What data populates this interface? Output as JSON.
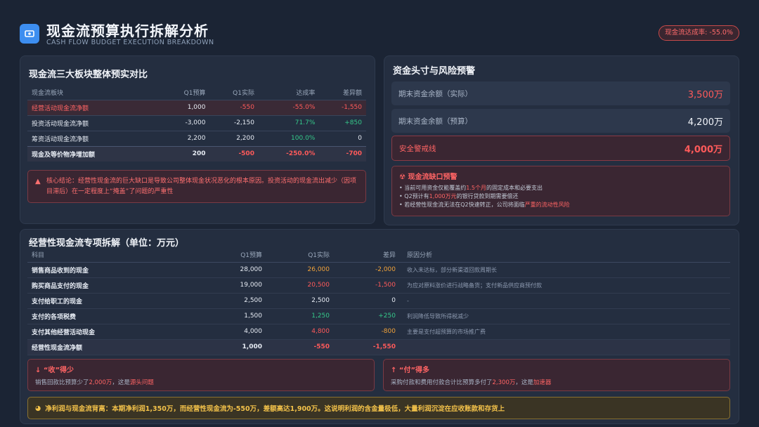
{
  "header": {
    "title": "现金流预算执行拆解分析",
    "subtitle": "CASH FLOW BUDGET EXECUTION BREAKDOWN",
    "rate_badge": "现金流达成率: -55.0%"
  },
  "panel_overview": {
    "title": "现金流三大板块整体预实对比",
    "columns": [
      "现金流板块",
      "Q1预算",
      "Q1实际",
      "达成率",
      "差异额"
    ],
    "rows": [
      {
        "name": "经营活动现金流净额",
        "budget": "1,000",
        "actual": "-550",
        "rate": "-55.0%",
        "diff": "-1,550"
      },
      {
        "name": "投资活动现金流净额",
        "budget": "-3,000",
        "actual": "-2,150",
        "rate": "71.7%",
        "diff": "+850"
      },
      {
        "name": "筹资活动现金流净额",
        "budget": "2,200",
        "actual": "2,200",
        "rate": "100.0%",
        "diff": "0"
      },
      {
        "name": "现金及等价物净增加额",
        "budget": "200",
        "actual": "-500",
        "rate": "-250.0%",
        "diff": "-700"
      }
    ],
    "conclusion": "核心结论：经营性现金流的巨大缺口是导致公司整体现金状况恶化的根本原因。投资活动的现金流出减少（因项目滞后）在一定程度上“掩盖”了问题的严重性"
  },
  "panel_position": {
    "title": "资金头寸与风险预警",
    "metrics": [
      {
        "label": "期末资金余额（实际）",
        "value": "3,500万"
      },
      {
        "label": "期末资金余额（预算）",
        "value": "4,200万"
      },
      {
        "label": "安全警戒线",
        "value": "4,000万"
      }
    ],
    "risk": {
      "title": "现金流缺口预警",
      "items": [
        {
          "pre": "当前可用资金仅能覆盖约",
          "hl": "1.5个月",
          "post": "的固定成本和必要支出"
        },
        {
          "pre": "Q2预计有",
          "hl": "1,000万元",
          "post": "的银行贷款到期需要偿还"
        },
        {
          "pre": "若经营性现金流无法在Q2快速转正，公司将面临",
          "hl": "严重的流动性风险",
          "post": ""
        }
      ]
    }
  },
  "panel_operating": {
    "title": "经营性现金流专项拆解（单位：万元）",
    "columns": [
      "科目",
      "Q1预算",
      "Q1实际",
      "差异",
      "原因分析"
    ],
    "rows": [
      {
        "name": "销售商品收到的现金",
        "budget": "28,000",
        "actual": "26,000",
        "diff": "-2,000",
        "note": "收入未达标，部分新渠道回款周期长"
      },
      {
        "name": "购买商品支付的现金",
        "budget": "19,000",
        "actual": "20,500",
        "diff": "-1,500",
        "note": "为应对原料涨价进行战略备货；支付新品供应商预付款"
      },
      {
        "name": "支付给职工的现金",
        "budget": "2,500",
        "actual": "2,500",
        "diff": "0",
        "note": "-"
      },
      {
        "name": "支付的各项税费",
        "budget": "1,500",
        "actual": "1,250",
        "diff": "+250",
        "note": "利润降低导致所得税减少"
      },
      {
        "name": "支付其他经营活动现金",
        "budget": "4,000",
        "actual": "4,800",
        "diff": "-800",
        "note": "主要是支付超预算的市场推广费"
      },
      {
        "name": "经营性现金流净额",
        "budget": "1,000",
        "actual": "-550",
        "diff": "-1,550",
        "note": ""
      }
    ],
    "card_left": {
      "title": "“收”得少",
      "pre": "销售回款比预算少了",
      "hl1": "2,000万",
      "mid": "，这是",
      "hl2": "源头问题"
    },
    "card_right": {
      "title": "“付”得多",
      "pre": "采购付款和费用付款合计比预算多付了",
      "hl1": "2,300万",
      "mid": "，这是",
      "hl2": "加速器"
    },
    "footer": "净利润与现金流背离：本期净利润1,350万，而经营性现金流为-550万，差额高达1,900万。这说明利润的含金量极低，大量利润沉淀在应收账款和存货上"
  },
  "colors": {
    "accent": "#3d8ef0",
    "danger": "#ff5a5a",
    "success": "#35c98a",
    "warning": "#f0a23a"
  }
}
